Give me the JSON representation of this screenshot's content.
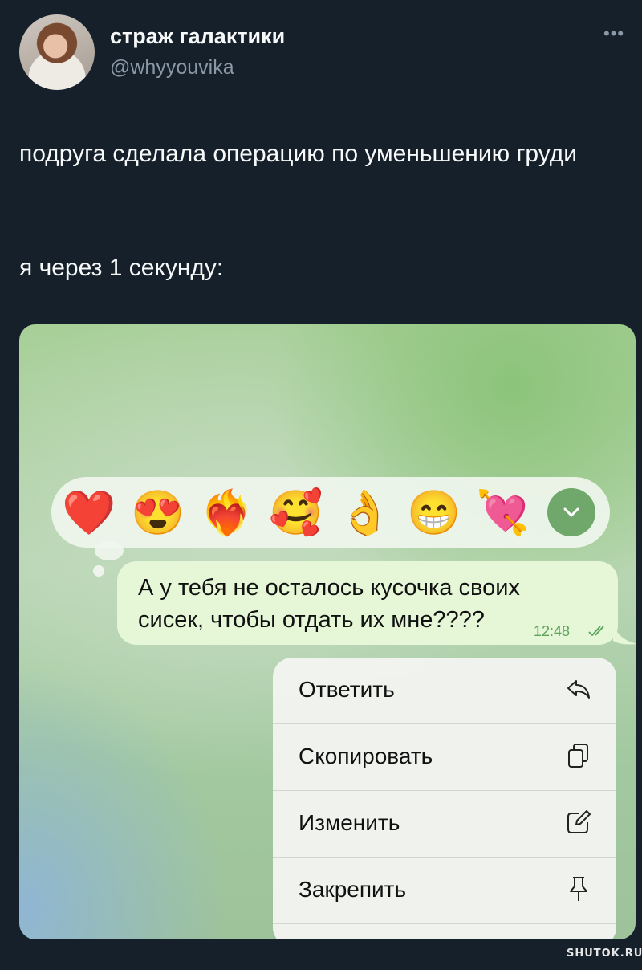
{
  "author": {
    "name": "страж галактики",
    "handle": "@whyyouvika"
  },
  "tweet": {
    "text_line1": "подруга сделала операцию по уменьшению груди",
    "text_line2": "я через 1 секунду:"
  },
  "reactions": [
    "❤️",
    "😍",
    "❤️‍🔥",
    "🥰",
    "👌",
    "😁",
    "💘"
  ],
  "message": {
    "text": "А у тебя не осталось кусочка своих сисек, чтобы отдать их мне????",
    "time": "12:48"
  },
  "menu": {
    "items": [
      {
        "label": "Ответить",
        "icon": "reply-icon"
      },
      {
        "label": "Скопировать",
        "icon": "copy-icon"
      },
      {
        "label": "Изменить",
        "icon": "edit-icon"
      },
      {
        "label": "Закрепить",
        "icon": "pin-icon"
      }
    ]
  },
  "watermark": "SHUTOK.RU"
}
